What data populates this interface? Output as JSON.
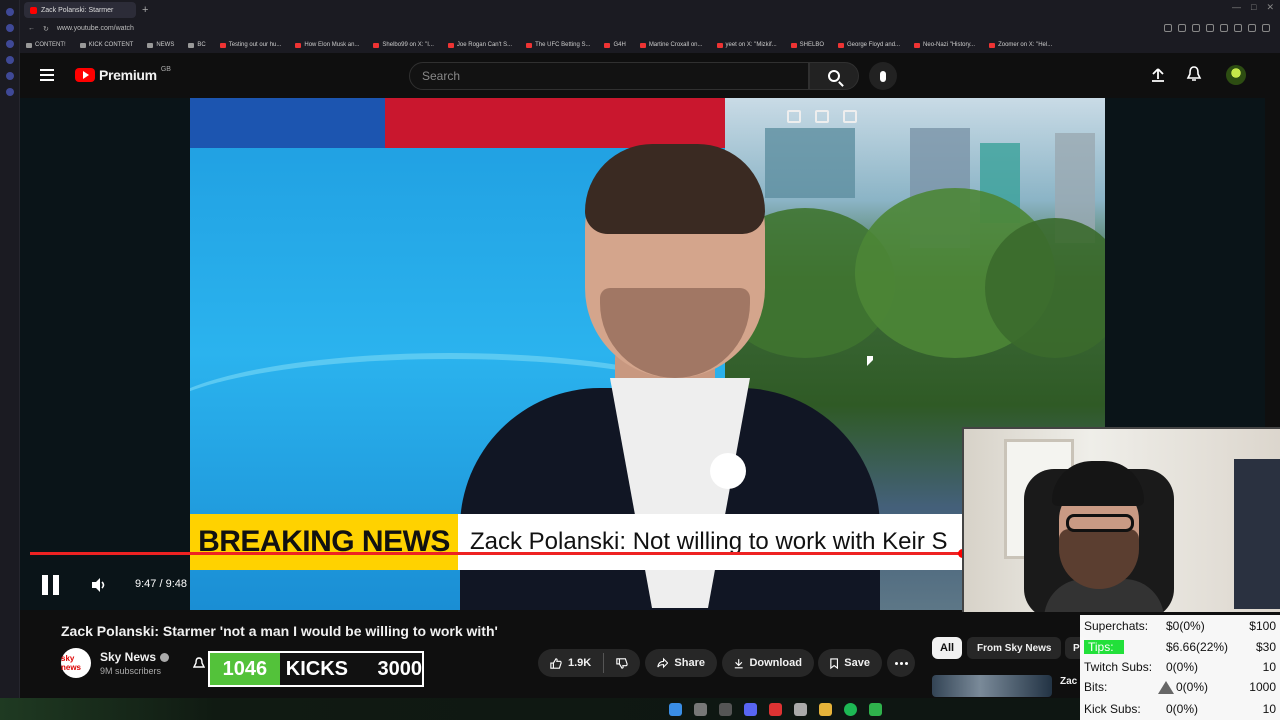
{
  "browser": {
    "tab_title": "Zack Polanski: Starmer",
    "url": "www.youtube.com/watch",
    "bookmarks": [
      "CONTENT!",
      "KICK CONTENT",
      "NEWS",
      "BC",
      "Testing out our hu...",
      "How Elon Musk an...",
      "Shelbo99 on X: \"I...",
      "Joe Rogan Can't S...",
      "The UFC Betting S...",
      "G4H",
      "Martine Croxall on...",
      "yeet on X: \"Mizkif...",
      "SHELBO",
      "George Floyd and...",
      "Neo-Nazi \"History...",
      "Zoomer on X: \"Hel..."
    ]
  },
  "header": {
    "logo_text": "Premium",
    "region": "GB",
    "search_placeholder": "Search"
  },
  "player": {
    "breaking_label": "BREAKING NEWS",
    "breaking_text": "Zack Polanski: Not willing to work with Keir S",
    "time": "9:47 / 9:48",
    "progress_fraction": 0.998
  },
  "video": {
    "title": "Zack Polanski: Starmer 'not a man I would be willing to work with'",
    "channel_name": "Sky News",
    "channel_avatar_text": "sky news",
    "subscribers": "9M subscribers",
    "likes": "1.9K",
    "share_label": "Share",
    "download_label": "Download",
    "save_label": "Save"
  },
  "kicks": {
    "count": "1046",
    "label": "KICKS",
    "goal": "3000"
  },
  "chips": {
    "all": "All",
    "from_channel": "From Sky News",
    "partial": "P"
  },
  "recommendation": {
    "title_partial": "Zac"
  },
  "stats": [
    {
      "label": "Superchats:",
      "value": "$0(0%)",
      "goal": "$100"
    },
    {
      "label": "Tips:",
      "value": "$6.66(22%)",
      "goal": "$30"
    },
    {
      "label": "Twitch Subs:",
      "value": "0(0%)",
      "goal": "10"
    },
    {
      "label": "Bits:",
      "value": "0(0%)",
      "goal": "1000"
    },
    {
      "label": "Kick Subs:",
      "value": "0(0%)",
      "goal": "10"
    }
  ],
  "colors": {
    "youtube_red": "#ff0000",
    "kicks_green": "#53c23a",
    "tips_green": "#22e03a",
    "breaking_yellow": "#ffd200"
  }
}
